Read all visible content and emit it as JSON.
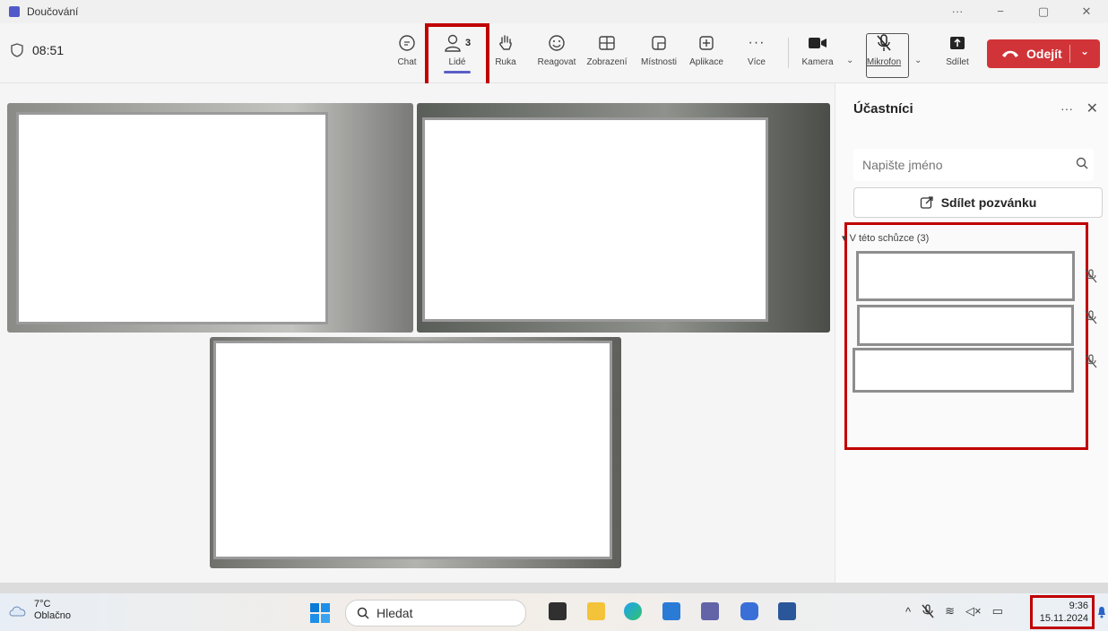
{
  "titlebar": {
    "title": "Doučování",
    "more": "···",
    "minimize": "−",
    "maximize": "▢",
    "close": "✕"
  },
  "toolbar": {
    "timer": "08:51",
    "buttons": {
      "chat": "Chat",
      "people": "Lidé",
      "people_count": "3",
      "hand": "Ruka",
      "react": "Reagovat",
      "view": "Zobrazení",
      "rooms": "Místnosti",
      "apps": "Aplikace",
      "more": "Více",
      "camera": "Kamera",
      "mic": "Mikrofon",
      "share": "Sdílet"
    },
    "leave": "Odejít"
  },
  "panel": {
    "title": "Účastníci",
    "more": "···",
    "close": "✕",
    "search_placeholder": "Napište jméno",
    "share_invite": "Sdílet pozvánku",
    "in_meeting": "V této schůzce (3)"
  },
  "taskbar": {
    "temperature": "7°C",
    "weather": "Oblačno",
    "search": "Hledat",
    "time": "9:36",
    "date": "15.11.2024"
  },
  "colors": {
    "accent": "#5b5fc7",
    "leave": "#d13438",
    "highlight": "#c00000"
  }
}
